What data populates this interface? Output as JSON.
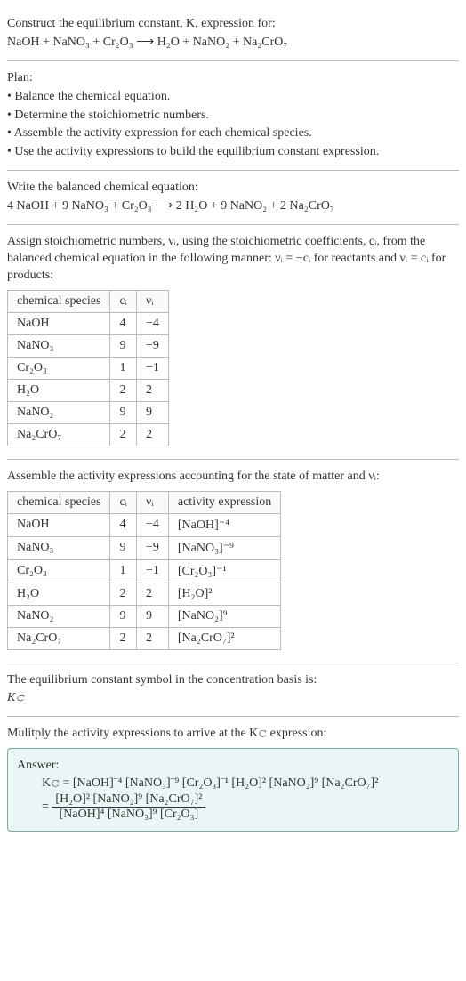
{
  "intro": {
    "line1": "Construct the equilibrium constant, K, expression for:",
    "eq": "NaOH + NaNO₃ + Cr₂O₃ ⟶ H₂O + NaNO₂ + Na₂CrO₇"
  },
  "plan": {
    "title": "Plan:",
    "items": [
      "• Balance the chemical equation.",
      "• Determine the stoichiometric numbers.",
      "• Assemble the activity expression for each chemical species.",
      "• Use the activity expressions to build the equilibrium constant expression."
    ]
  },
  "balanced": {
    "title": "Write the balanced chemical equation:",
    "eq": "4 NaOH + 9 NaNO₃ + Cr₂O₃ ⟶ 2 H₂O + 9 NaNO₂ + 2 Na₂CrO₇"
  },
  "assign": {
    "text": "Assign stoichiometric numbers, νᵢ, using the stoichiometric coefficients, cᵢ, from the balanced chemical equation in the following manner: νᵢ = −cᵢ for reactants and νᵢ = cᵢ for products:",
    "headers": [
      "chemical species",
      "cᵢ",
      "νᵢ"
    ],
    "rows": [
      {
        "sp": "NaOH",
        "c": "4",
        "v": "−4"
      },
      {
        "sp": "NaNO₃",
        "c": "9",
        "v": "−9"
      },
      {
        "sp": "Cr₂O₃",
        "c": "1",
        "v": "−1"
      },
      {
        "sp": "H₂O",
        "c": "2",
        "v": "2"
      },
      {
        "sp": "NaNO₂",
        "c": "9",
        "v": "9"
      },
      {
        "sp": "Na₂CrO₇",
        "c": "2",
        "v": "2"
      }
    ]
  },
  "activity": {
    "title": "Assemble the activity expressions accounting for the state of matter and νᵢ:",
    "headers": [
      "chemical species",
      "cᵢ",
      "νᵢ",
      "activity expression"
    ],
    "rows": [
      {
        "sp": "NaOH",
        "c": "4",
        "v": "−4",
        "a": "[NaOH]⁻⁴"
      },
      {
        "sp": "NaNO₃",
        "c": "9",
        "v": "−9",
        "a": "[NaNO₃]⁻⁹"
      },
      {
        "sp": "Cr₂O₃",
        "c": "1",
        "v": "−1",
        "a": "[Cr₂O₃]⁻¹"
      },
      {
        "sp": "H₂O",
        "c": "2",
        "v": "2",
        "a": "[H₂O]²"
      },
      {
        "sp": "NaNO₂",
        "c": "9",
        "v": "9",
        "a": "[NaNO₂]⁹"
      },
      {
        "sp": "Na₂CrO₇",
        "c": "2",
        "v": "2",
        "a": "[Na₂CrO₇]²"
      }
    ]
  },
  "symbol": {
    "line1": "The equilibrium constant symbol in the concentration basis is:",
    "line2": "K𝚌"
  },
  "multiply": {
    "title": "Mulitply the activity expressions to arrive at the K𝚌 expression:"
  },
  "answer": {
    "label": "Answer:",
    "line1": "K𝚌 = [NaOH]⁻⁴ [NaNO₃]⁻⁹ [Cr₂O₃]⁻¹ [H₂O]² [NaNO₂]⁹ [Na₂CrO₇]²",
    "eq_prefix": "= ",
    "num": "[H₂O]² [NaNO₂]⁹ [Na₂CrO₇]²",
    "den": "[NaOH]⁴ [NaNO₃]⁹ [Cr₂O₃]"
  },
  "chart_data": {
    "type": "table",
    "tables": [
      {
        "title": "Stoichiometric numbers",
        "columns": [
          "chemical species",
          "c_i",
          "ν_i"
        ],
        "rows": [
          [
            "NaOH",
            4,
            -4
          ],
          [
            "NaNO3",
            9,
            -9
          ],
          [
            "Cr2O3",
            1,
            -1
          ],
          [
            "H2O",
            2,
            2
          ],
          [
            "NaNO2",
            9,
            9
          ],
          [
            "Na2CrO7",
            2,
            2
          ]
        ]
      },
      {
        "title": "Activity expressions",
        "columns": [
          "chemical species",
          "c_i",
          "ν_i",
          "activity expression"
        ],
        "rows": [
          [
            "NaOH",
            4,
            -4,
            "[NaOH]^-4"
          ],
          [
            "NaNO3",
            9,
            -9,
            "[NaNO3]^-9"
          ],
          [
            "Cr2O3",
            1,
            -1,
            "[Cr2O3]^-1"
          ],
          [
            "H2O",
            2,
            2,
            "[H2O]^2"
          ],
          [
            "NaNO2",
            9,
            9,
            "[NaNO2]^9"
          ],
          [
            "Na2CrO7",
            2,
            2,
            "[Na2CrO7]^2"
          ]
        ]
      }
    ]
  }
}
